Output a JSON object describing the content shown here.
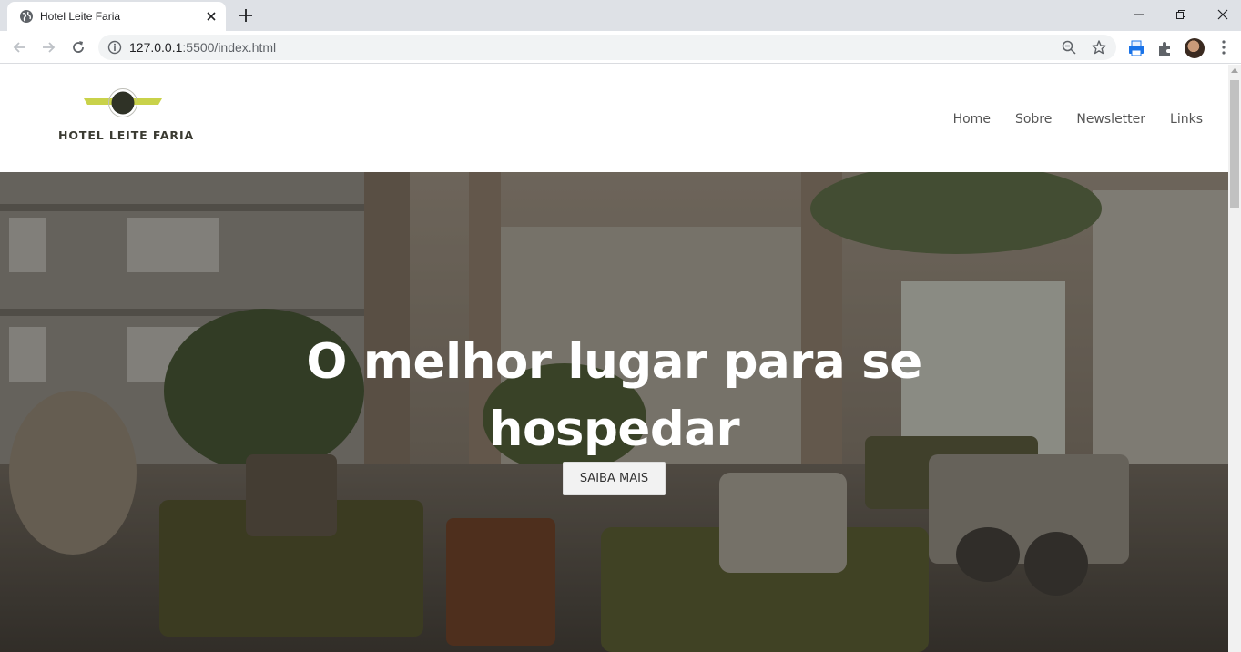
{
  "browser": {
    "tab_title": "Hotel Leite Faria",
    "url_host": "127.0.0.1",
    "url_rest": ":5500/index.html"
  },
  "site": {
    "logo_text": "HOTEL LEITE FARIA",
    "nav": [
      "Home",
      "Sobre",
      "Newsletter",
      "Links"
    ],
    "hero": {
      "title": "O melhor lugar para se hospedar",
      "button": "SAIBA MAIS"
    }
  },
  "colors": {
    "logo_accent": "#c9d24a",
    "logo_dark": "#2f3226"
  }
}
